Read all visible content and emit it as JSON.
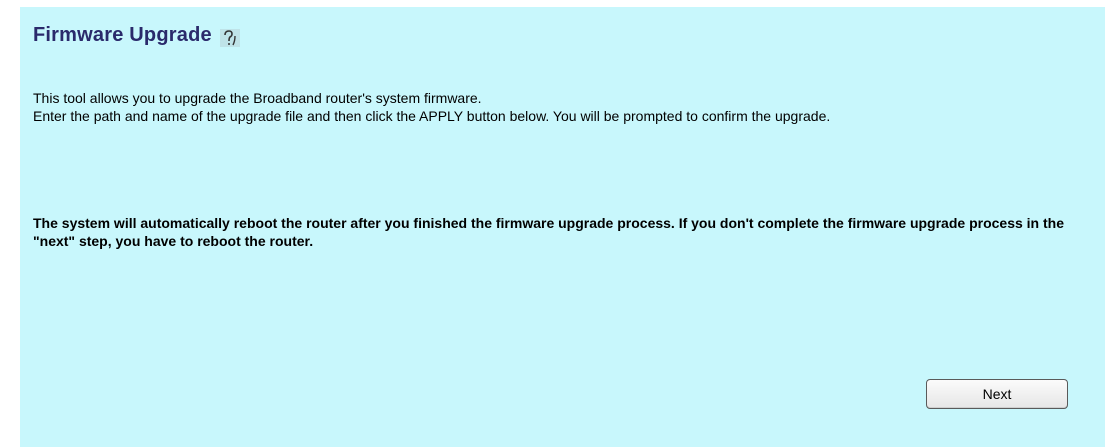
{
  "header": {
    "title": "Firmware Upgrade",
    "help_icon": "help-question-icon"
  },
  "description": {
    "line1": "This tool allows you to upgrade the Broadband router's system firmware.",
    "line2": "Enter the path and name of the upgrade file and then click the APPLY button below. You will be prompted to confirm the upgrade."
  },
  "warning": {
    "text": "The system will automatically reboot the router after you finished the firmware upgrade process. If you don't complete the firmware upgrade process in the \"next\" step, you have to reboot the router."
  },
  "actions": {
    "next_label": "Next"
  },
  "colors": {
    "panel_background": "#c8f7fc",
    "title_color": "#2a2a6b"
  }
}
